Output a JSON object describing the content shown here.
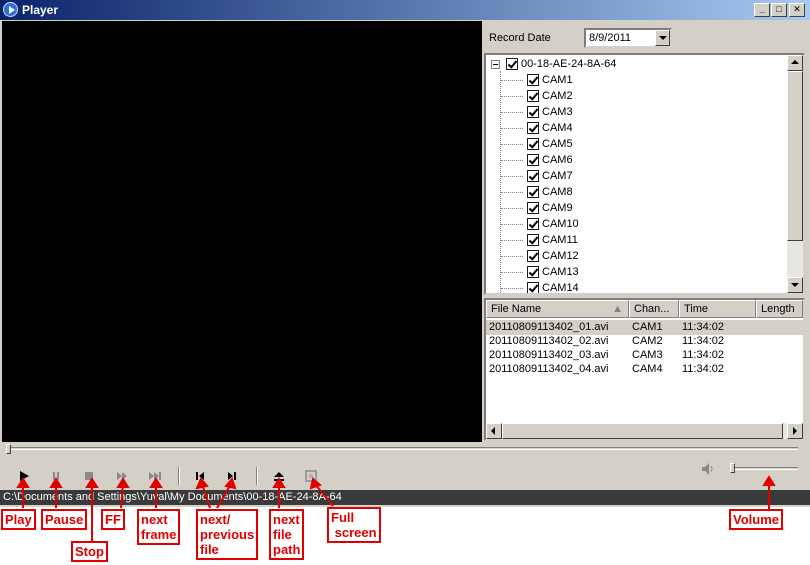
{
  "window": {
    "title": "Player"
  },
  "title_buttons": {
    "minimize": "_",
    "maximize": "□",
    "close": "✕"
  },
  "record_date": {
    "label": "Record Date",
    "value": "8/9/2011"
  },
  "tree": {
    "root_label": "00-18-AE-24-8A-64",
    "cameras": [
      "CAM1",
      "CAM2",
      "CAM3",
      "CAM4",
      "CAM5",
      "CAM6",
      "CAM7",
      "CAM8",
      "CAM9",
      "CAM10",
      "CAM11",
      "CAM12",
      "CAM13",
      "CAM14"
    ]
  },
  "file_list": {
    "columns": [
      "File Name",
      "Chan...",
      "Time",
      "Length"
    ],
    "rows": [
      {
        "file": "20110809113402_01.avi",
        "channel": "CAM1",
        "time": "11:34:02",
        "length": ""
      },
      {
        "file": "20110809113402_02.avi",
        "channel": "CAM2",
        "time": "11:34:02",
        "length": ""
      },
      {
        "file": "20110809113402_03.avi",
        "channel": "CAM3",
        "time": "11:34:02",
        "length": ""
      },
      {
        "file": "20110809113402_04.avi",
        "channel": "CAM4",
        "time": "11:34:02",
        "length": ""
      }
    ]
  },
  "controls": {
    "icons": [
      "play-icon",
      "pause-icon",
      "stop-icon",
      "fast-forward-icon",
      "next-frame-icon",
      "previous-file-icon",
      "next-file-icon",
      "eject-icon",
      "full-screen-icon",
      "speaker-icon"
    ]
  },
  "status": {
    "path": "C:\\Documents and Settings\\Yuval\\My Documents\\00-18-AE-24-8A-64"
  },
  "annotations": {
    "play": "Play",
    "pause": "Pause",
    "stop": "Stop",
    "ff": "FF",
    "next_frame": "next\nframe",
    "next_prev_file": "next/\nprevious\nfile",
    "next_file_path": "next\nfile\npath",
    "full_screen": "Full\n screen",
    "volume": "Volume"
  },
  "colors": {
    "annotation": "#e00000",
    "titlebar_start": "#0a246a",
    "titlebar_end": "#a6caf0",
    "face": "#d4d0c8"
  }
}
